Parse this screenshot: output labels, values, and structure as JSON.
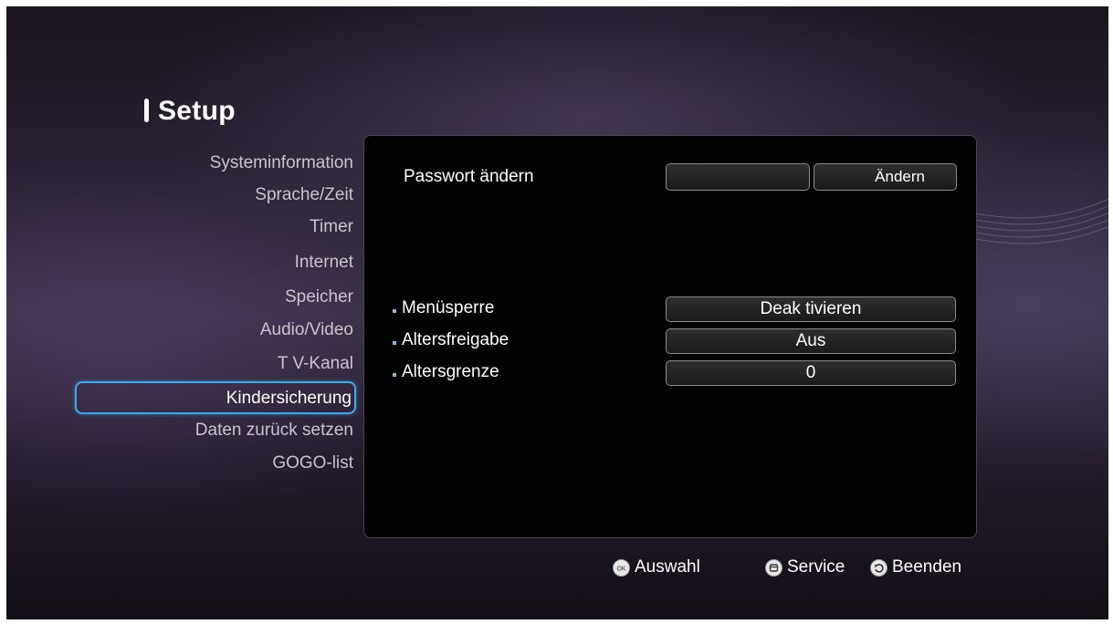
{
  "header": {
    "title": "Setup"
  },
  "sidebar": {
    "items": [
      {
        "label": "Systeminformation"
      },
      {
        "label": "Sprache/Zeit"
      },
      {
        "label": "Timer"
      },
      {
        "label": "Internet"
      },
      {
        "label": "Speicher"
      },
      {
        "label": "Audio/Video"
      },
      {
        "label": "T V-Kanal"
      },
      {
        "label": "Kindersicherung",
        "selected": true
      },
      {
        "label": "Daten zurück setzen"
      },
      {
        "label": "GOGO-list"
      }
    ]
  },
  "panel": {
    "password": {
      "label": "Passwort ändern",
      "value": "",
      "button_label": "Ändern"
    },
    "settings": [
      {
        "label": "Menüsperre",
        "value": "Deak tivieren"
      },
      {
        "label": "Altersfreigabe",
        "value": "Aus"
      },
      {
        "label": "Altersgrenze",
        "value": "0"
      }
    ]
  },
  "footer": {
    "ok_icon": "OK",
    "select_label": "Auswahl",
    "service_label": "Service",
    "exit_label": "Beenden"
  },
  "colors": {
    "selection_border": "#3fa9e6",
    "panel_background": "#030303",
    "bullet": "#7fb8e0"
  }
}
